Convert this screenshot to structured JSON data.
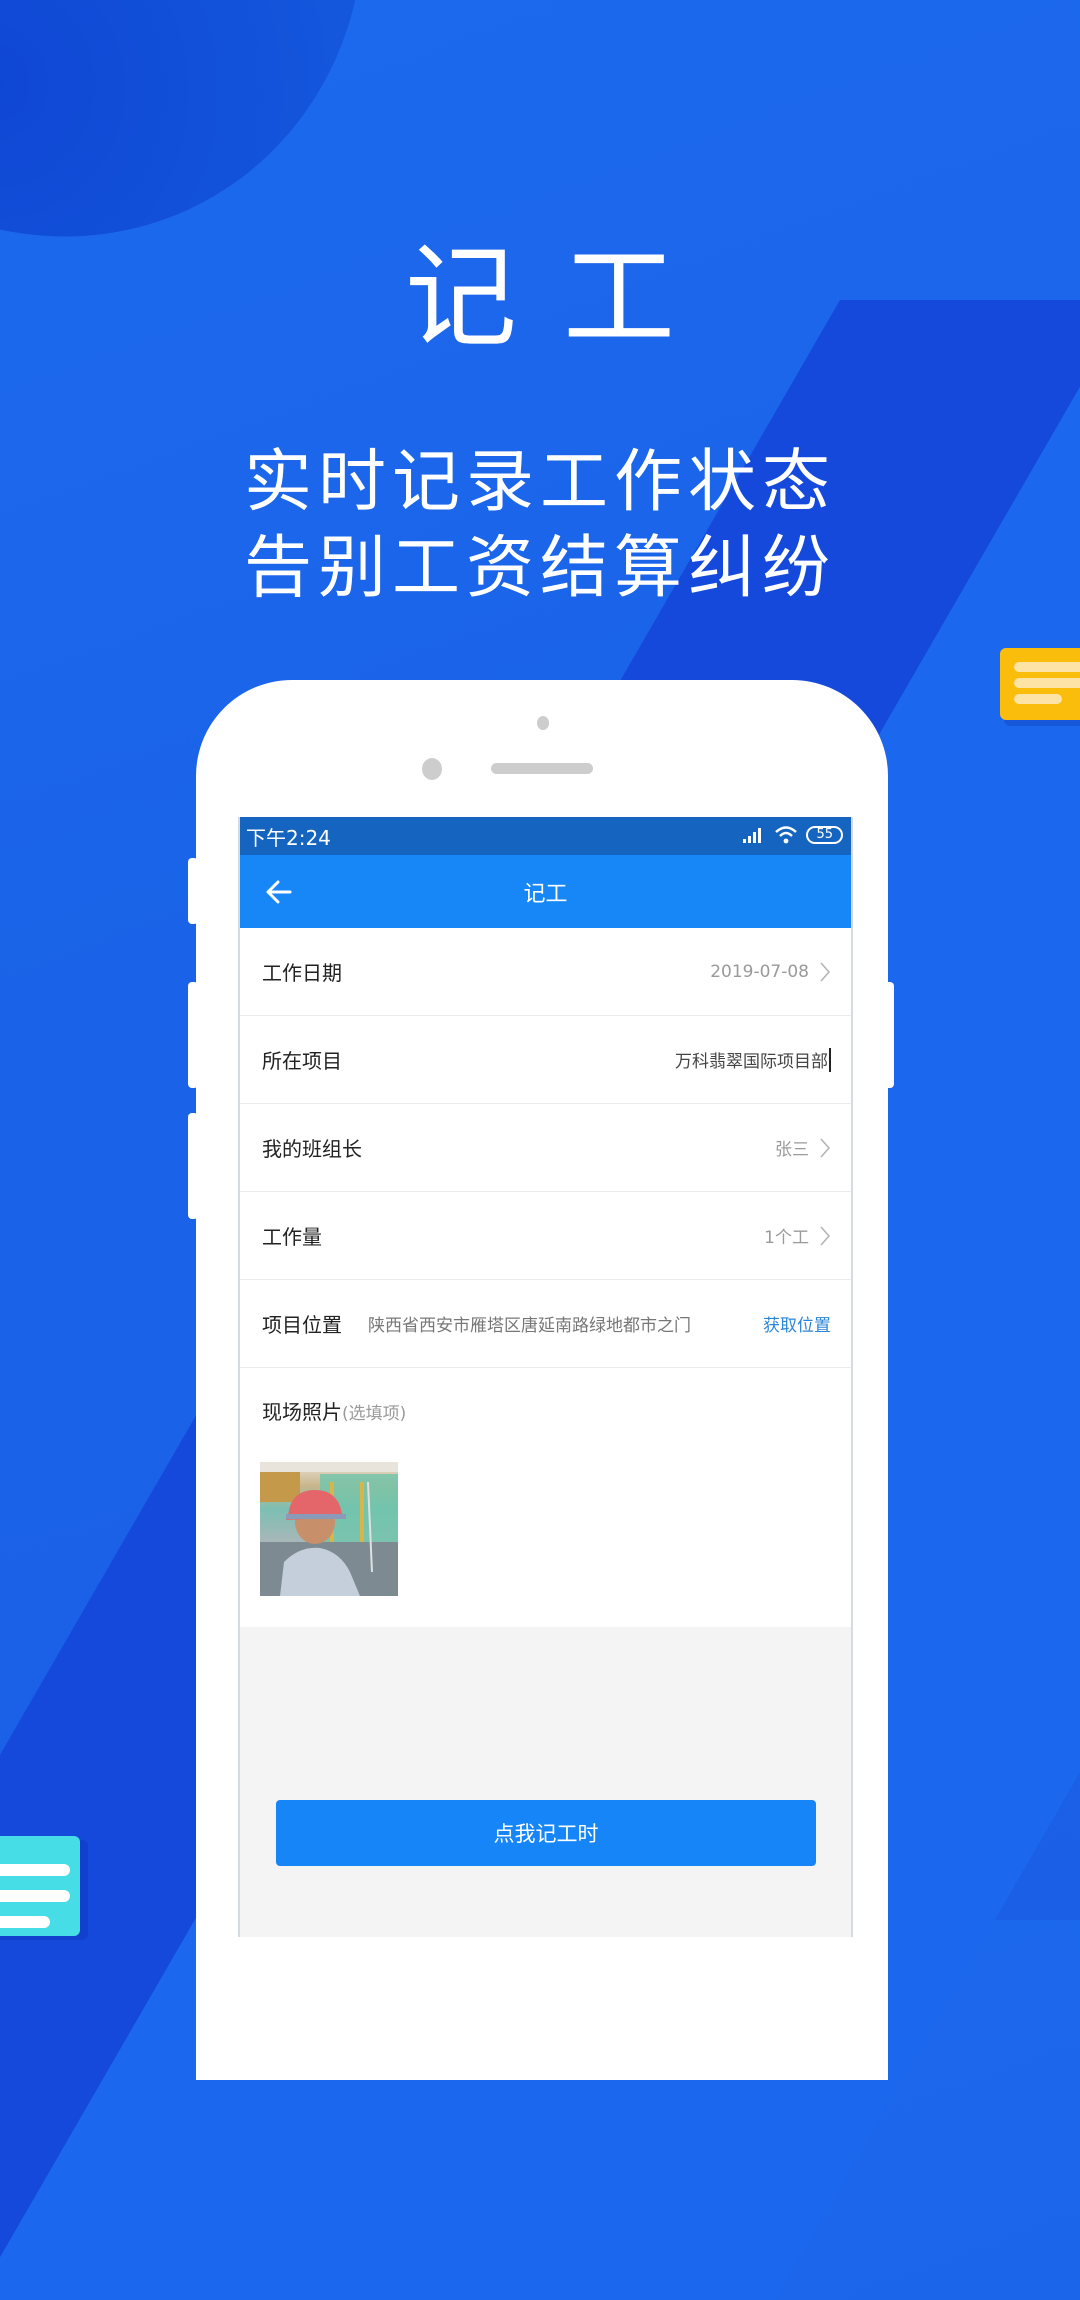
{
  "promo": {
    "headline": "记工",
    "tagline_line1": "实时记录工作状态",
    "tagline_line2": "告别工资结算纠纷"
  },
  "status_bar": {
    "time": "下午2:24",
    "signal_icon": "signal-icon",
    "wifi_icon": "wifi-icon",
    "battery": "55"
  },
  "nav": {
    "title": "记工",
    "back_icon": "arrow-left-icon"
  },
  "form": {
    "rows": [
      {
        "label": "工作日期",
        "value": "2019-07-08"
      },
      {
        "label": "所在项目",
        "value": "万科翡翠国际项目部"
      },
      {
        "label": "我的班组长",
        "value": "张三"
      },
      {
        "label": "工作量",
        "value": "1个工"
      },
      {
        "label": "项目位置",
        "value": "陕西省西安市雁塔区唐延南路绿地都市之门",
        "action": "获取位置"
      }
    ],
    "photo": {
      "label": "现场照片",
      "optional": "(选填项)"
    }
  },
  "submit_button": "点我记工时",
  "colors": {
    "background": "#1a63e8",
    "status_bar": "#1565c0",
    "nav_bar": "#1787f7",
    "accent_link": "#2d86d8",
    "button": "#1585f8",
    "deco_yellow": "#fbbd0b",
    "deco_teal": "#46dde6"
  }
}
